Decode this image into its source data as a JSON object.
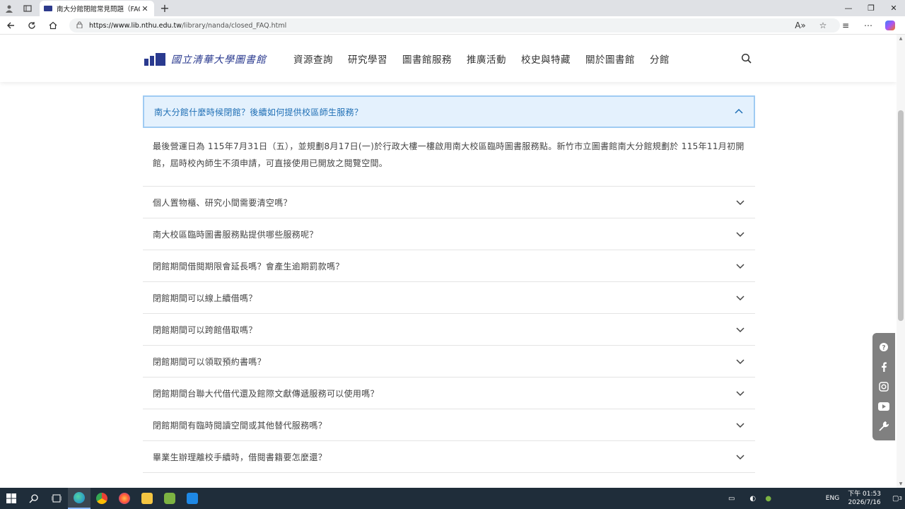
{
  "browser": {
    "tab_title": "南大分館閉館常見問題（FAQ）|",
    "tab_close": "✕",
    "new_tab": "+",
    "url_host": "https://www.lib.nthu.edu.tw",
    "url_path": "/library/nanda/closed_FAQ.html",
    "window_controls": [
      "—",
      "❐",
      "✕"
    ]
  },
  "site": {
    "logo_text": "國立清華大學圖書館",
    "nav": [
      "資源查詢",
      "研究學習",
      "圖書館服務",
      "推廣活動",
      "校史與特藏",
      "關於圖書館",
      "分館"
    ]
  },
  "faq": {
    "open_question": "南大分館什麼時候閉館？後續如何提供校區師生服務？",
    "open_answer": "最後營運日為 115年7月31日（五），並規劃8月17日(一)於行政大樓一樓啟用南大校區臨時圖書服務點。新竹市立圖書館南大分館規劃於 115年11月初開館，屆時校內師生不須申請，可直接使用已開放之閱覽空間。",
    "items": [
      "個人置物櫃、研究小間需要清空嗎？",
      "南大校區臨時圖書服務點提供哪些服務呢？",
      "閉館期間借閱期限會延長嗎？會產生逾期罰款嗎？",
      "閉館期間可以線上續借嗎？",
      "閉館期間可以跨館借取嗎？",
      "閉館期間可以領取預約書嗎？",
      "閉館期間台聯大代借代還及館際文獻傳遞服務可以使用嗎？",
      "閉館期間有臨時閱讀空間或其他替代服務嗎？",
      "畢業生辦理離校手續時，借閱書籍要怎麼還？"
    ]
  },
  "taskbar": {
    "lang": "ENG",
    "time": "下午 01:53",
    "date": "2026/7/16",
    "notification_count": "3"
  },
  "colors": {
    "accent": "#1f6fb5",
    "open_bg": "#e4f1fd",
    "open_border": "#9fcbf3",
    "logo": "#2a3a8f"
  }
}
